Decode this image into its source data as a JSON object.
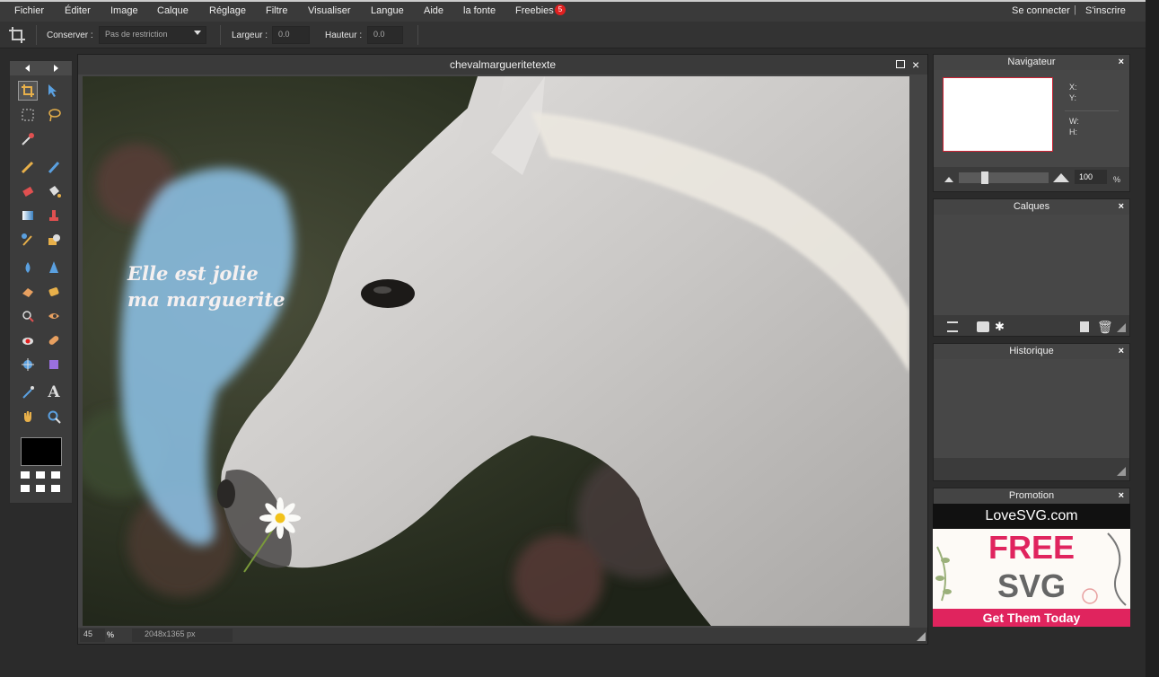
{
  "menu": {
    "items": [
      "Fichier",
      "Éditer",
      "Image",
      "Calque",
      "Réglage",
      "Filtre",
      "Visualiser",
      "Langue",
      "Aide",
      "la fonte",
      "Freebies"
    ],
    "freebies_badge": "5",
    "login": "Se connecter",
    "separator": "|",
    "signup": "S'inscrire"
  },
  "options": {
    "conserver_label": "Conserver :",
    "conserver_value": "Pas de restriction",
    "largeur_label": "Largeur :",
    "largeur_value": "0.0",
    "hauteur_label": "Hauteur :",
    "hauteur_value": "0.0"
  },
  "document": {
    "title": "chevalmargueritetexte",
    "text_line1": "Elle est jolie",
    "text_line2": "ma marguerite",
    "zoom": "45",
    "zoom_unit": "%",
    "dimensions": "2048x1365 px"
  },
  "navigator": {
    "title": "Navigateur",
    "x_label": "X:",
    "y_label": "Y:",
    "w_label": "W:",
    "h_label": "H:",
    "zoom_value": "100",
    "zoom_unit": "%"
  },
  "layers": {
    "title": "Calques"
  },
  "history": {
    "title": "Historique"
  },
  "promotion": {
    "title": "Promotion",
    "brand": "LoveSVG.com",
    "free": "FREE",
    "svg": "SVG",
    "cta": "Get Them Today"
  },
  "colors": {
    "accent_red": "#e02020",
    "promo_pink": "#e0245e",
    "foreground": "#000000"
  }
}
